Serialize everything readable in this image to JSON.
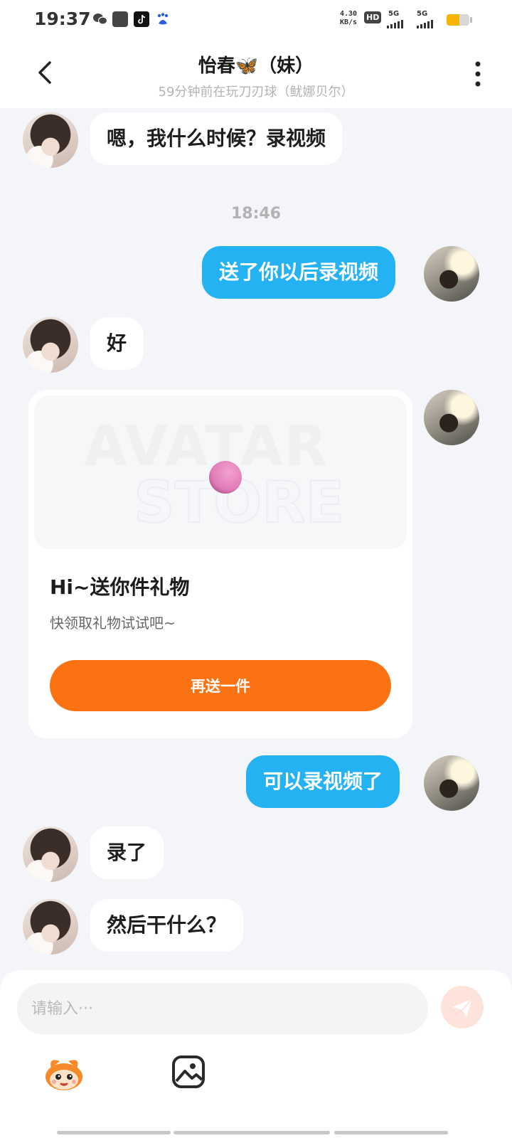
{
  "status_bar": {
    "time": "19:37",
    "net_speed_value": "4.30",
    "net_speed_unit": "KB/s",
    "hd_label": "HD",
    "sim1_label": "5G",
    "sim2_label": "5G",
    "battery_level": 0.55,
    "icons": [
      "wechat-icon",
      "mail-icon",
      "tiktok-icon",
      "baidu-icon"
    ]
  },
  "header": {
    "title": "怡春🦋（妹）",
    "subtitle": "59分钟前在玩刀刃球（鱿娜贝尔）"
  },
  "messages": [
    {
      "side": "in",
      "text": "嗯，我什么时候？录视频"
    },
    {
      "side": "time",
      "text": "18:46"
    },
    {
      "side": "out",
      "text": "送了你以后录视频"
    },
    {
      "side": "in",
      "text": "好"
    },
    {
      "side": "out_gift"
    },
    {
      "side": "out",
      "text": "可以录视频了"
    },
    {
      "side": "in",
      "text": "录了"
    },
    {
      "side": "in",
      "text": "然后干什么？"
    }
  ],
  "gift_card": {
    "watermark_line1": "AVATAR",
    "watermark_line2": "STORE",
    "title": "Hi~送你件礼物",
    "description": "快领取礼物试试吧~",
    "button_label": "再送一件"
  },
  "composer": {
    "placeholder": "请输入···",
    "value": ""
  },
  "colors": {
    "outgoing_bubble": "#25b2f3",
    "incoming_bubble": "#ffffff",
    "gift_button": "#fb7212",
    "page_background": "#f3f5f8"
  }
}
